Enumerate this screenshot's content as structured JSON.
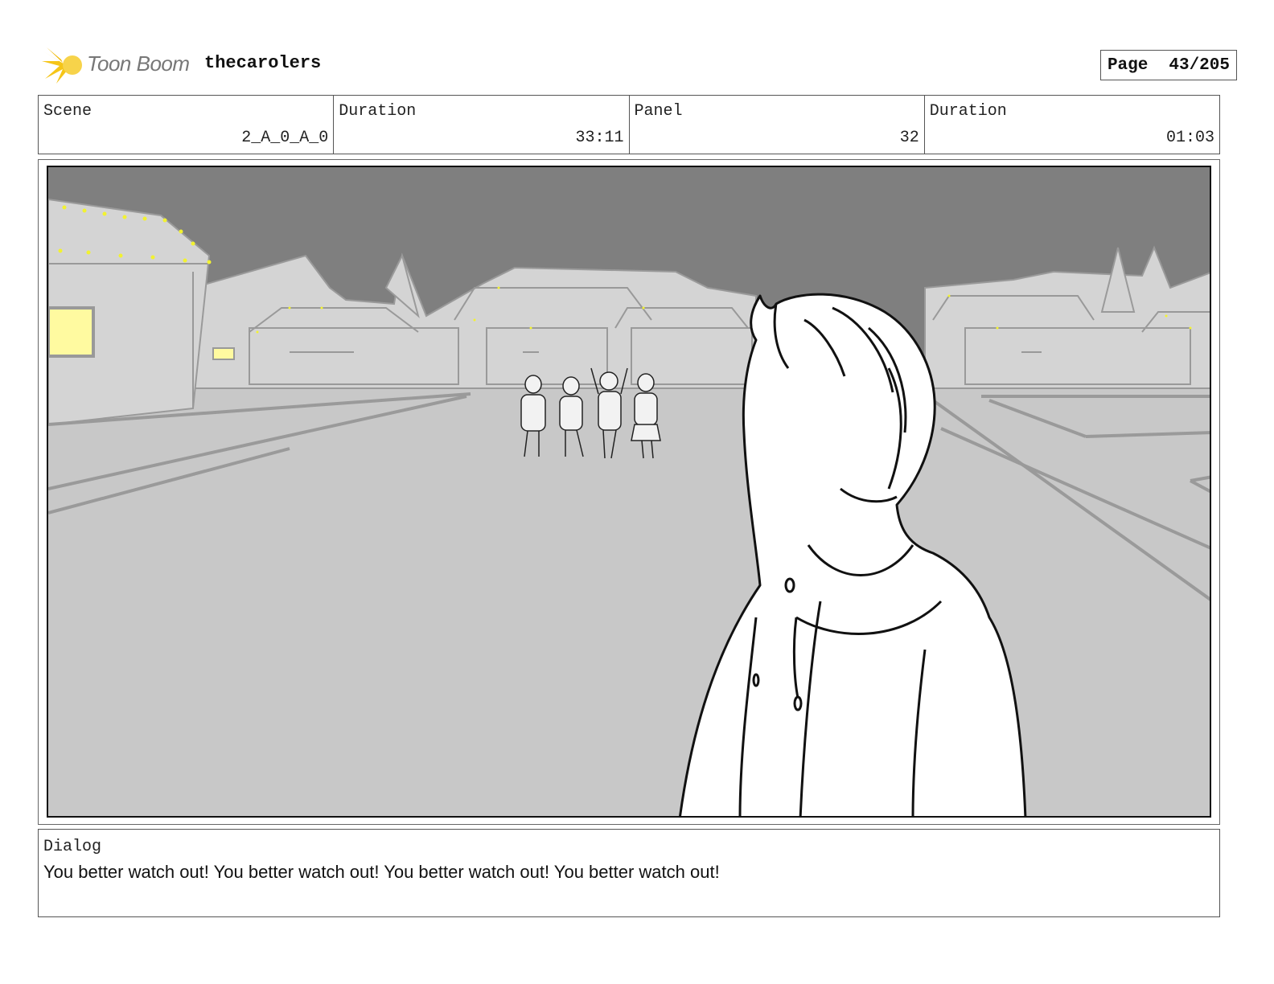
{
  "header": {
    "logo_text": "Toon Boom",
    "project_name": "thecarolers",
    "page_label": "Page",
    "page_value": "43/205"
  },
  "info": {
    "scene_label": "Scene",
    "scene_value": "2_A_0_A_0",
    "scene_duration_label": "Duration",
    "scene_duration_value": "33:11",
    "panel_label": "Panel",
    "panel_value": "32",
    "panel_duration_label": "Duration",
    "panel_duration_value": "01:03"
  },
  "dialog": {
    "label": "Dialog",
    "text": "You better watch out! You better watch out! You better watch out! You better watch out!"
  },
  "colors": {
    "sky": "#7f7f7f",
    "ground": "#c8c8c8",
    "buildings": "#d4d4d4",
    "lights": "#f2f230",
    "window": "#fffaa0",
    "logo_accent": "#f5c518"
  }
}
